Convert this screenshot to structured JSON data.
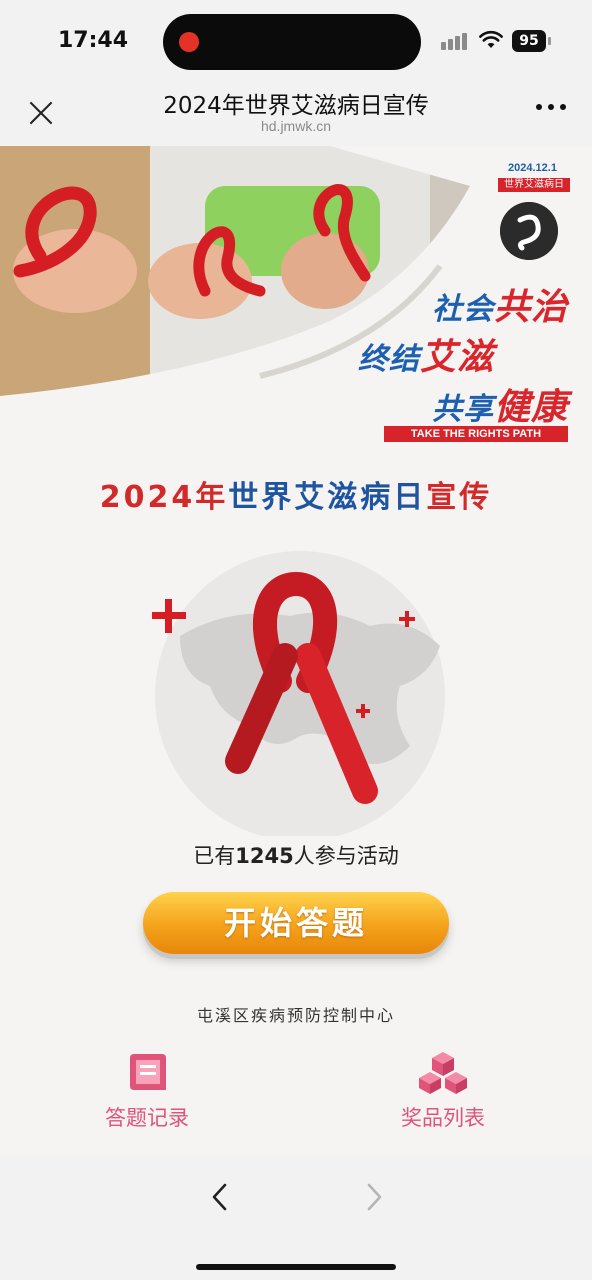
{
  "status_bar": {
    "time": "17:44",
    "battery": "95"
  },
  "nav": {
    "title": "2024年世界艾滋病日宣传",
    "url": "hd.jmwk.cn",
    "close_icon": "close-icon",
    "more_icon": "more-icon"
  },
  "banner": {
    "date": "2024.12.1",
    "tag": "世界艾滋病日",
    "slogan_lines": [
      {
        "blue": "社会",
        "red": "共治"
      },
      {
        "blue": "终结",
        "red": "艾滋"
      },
      {
        "blue": "共享",
        "red": "健康"
      }
    ],
    "english": "TAKE THE RIGHTS PATH"
  },
  "main": {
    "title_red_1": "2024年",
    "title_blue": "世界艾滋病日",
    "title_red_2": "宣传",
    "count_prefix": "已有",
    "count_value": "1245",
    "count_suffix": "人参与活动",
    "start_button": "开始答题",
    "organizer": "屯溪区疾病预防控制中心"
  },
  "tabs": [
    {
      "label": "答题记录",
      "icon": "book-icon"
    },
    {
      "label": "奖品列表",
      "icon": "boxes-icon"
    }
  ],
  "colors": {
    "accent_red": "#d22a2a",
    "accent_blue": "#1f55a0",
    "button_orange": "#f4a21b",
    "tab_pink": "#e0547a"
  }
}
